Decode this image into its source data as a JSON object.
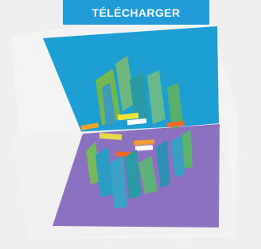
{
  "download_button": {
    "label": "TÉLÉCHARGER",
    "color": "#1f9bd7"
  },
  "image": {
    "subject": "pop-up-card",
    "colors": {
      "blue_panel": "#1e9fd4",
      "purple_panel": "#8a6fbf",
      "card_white": "#f1f1f1",
      "background": "#ececec"
    }
  }
}
